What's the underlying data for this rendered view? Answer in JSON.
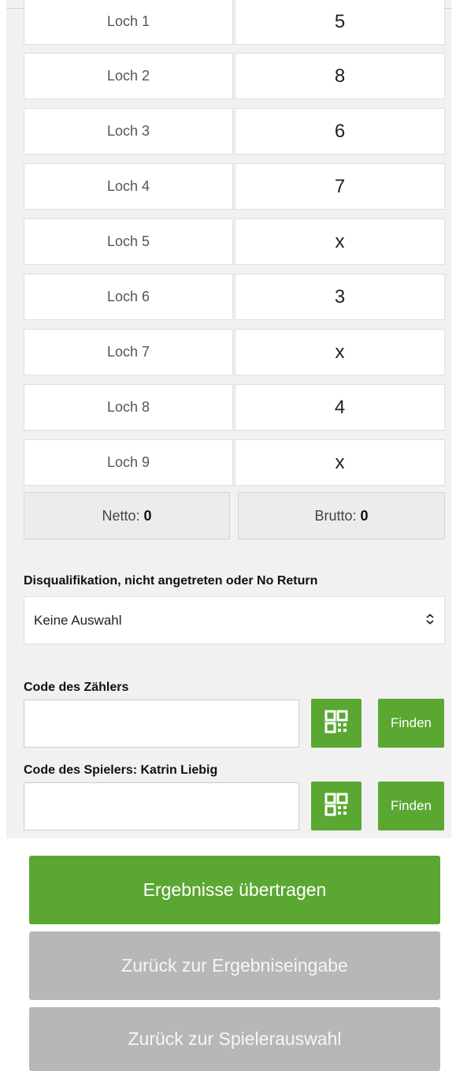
{
  "holes": [
    {
      "label": "Loch 1",
      "score": "5"
    },
    {
      "label": "Loch 2",
      "score": "8"
    },
    {
      "label": "Loch 3",
      "score": "6"
    },
    {
      "label": "Loch 4",
      "score": "7"
    },
    {
      "label": "Loch 5",
      "score": "x"
    },
    {
      "label": "Loch 6",
      "score": "3"
    },
    {
      "label": "Loch 7",
      "score": "x"
    },
    {
      "label": "Loch 8",
      "score": "4"
    },
    {
      "label": "Loch 9",
      "score": "x"
    }
  ],
  "totals": {
    "netto_label": "Netto:",
    "netto_value": "0",
    "brutto_label": "Brutto:",
    "brutto_value": "0"
  },
  "disqualification": {
    "label": "Disqualifikation, nicht angetreten oder No Return",
    "selected": "Keine Auswahl"
  },
  "marker_code": {
    "label": "Code des Zählers",
    "value": "",
    "find_label": "Finden"
  },
  "player_code": {
    "label": "Code des Spielers: Katrin Liebig",
    "value": "",
    "find_label": "Finden"
  },
  "actions": {
    "submit": "Ergebnisse übertragen",
    "back_entry": "Zurück zur Ergebniseingabe",
    "back_players": "Zurück zur Spielerauswahl"
  },
  "colors": {
    "accent_green": "#5aa832",
    "disabled_grey": "#b7b7b7"
  },
  "icons": {
    "qr": "qr-code-icon",
    "select": "chevron-up-down-icon"
  }
}
